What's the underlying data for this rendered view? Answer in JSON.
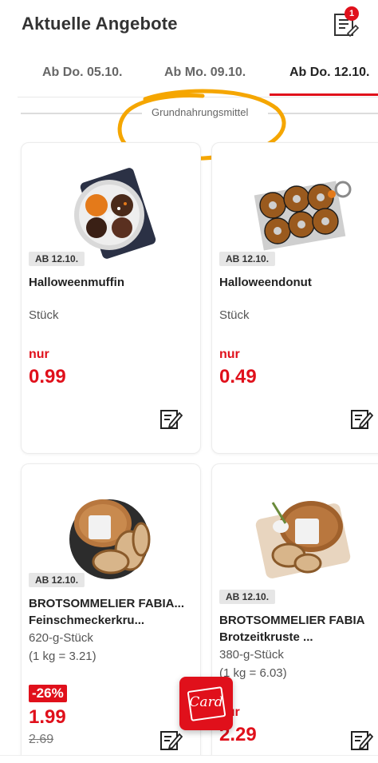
{
  "header": {
    "title": "Aktuelle Angebote",
    "list_badge_count": "1",
    "list_icon": "shopping-list-icon"
  },
  "tabs": [
    {
      "label": "Ab Do. 05.10.",
      "active": false
    },
    {
      "label": "Ab Mo. 09.10.",
      "active": false
    },
    {
      "label": "Ab Do. 12.10.",
      "active": true
    }
  ],
  "section": {
    "label": "Grundnahrungsmittel"
  },
  "products": [
    {
      "date_badge": "AB 12.10.",
      "name": "Halloweenmuffin",
      "unit": "Stück",
      "price_prefix": "nur",
      "price": "0.99",
      "image": "halloween-muffin-image"
    },
    {
      "date_badge": "AB 12.10.",
      "name": "Halloweendonut",
      "unit": "Stück",
      "price_prefix": "nur",
      "price": "0.49",
      "image": "halloween-donut-image"
    },
    {
      "date_badge": "AB 12.10.",
      "name_line1": "BROTSOMMELIER FABIA...",
      "name_line2": "Feinschmeckerkru...",
      "unit": "620-g-Stück",
      "base_price": "(1 kg = 3.21)",
      "discount": "-26%",
      "price": "1.99",
      "old_price": "2.69",
      "image": "bread-loaf-image"
    },
    {
      "date_badge": "AB 12.10.",
      "name_line1": "BROTSOMMELIER FABIA",
      "name_line2": "Brotzeitkruste ...",
      "unit": "380-g-Stück",
      "base_price": "(1 kg = 6.03)",
      "price_prefix": "nur",
      "price": "2.29",
      "image": "bread-crust-image"
    }
  ],
  "card_button": {
    "label": "Card"
  },
  "colors": {
    "accent": "#e0101b",
    "highlight_scribble": "#f5a600"
  }
}
